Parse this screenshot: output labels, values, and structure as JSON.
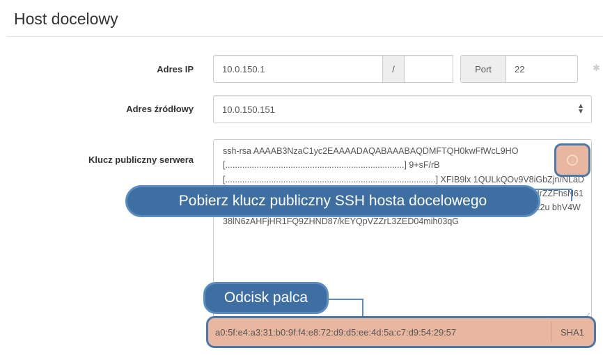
{
  "section": {
    "title": "Host docelowy"
  },
  "ip": {
    "label": "Adres IP",
    "value": "10.0.150.1",
    "mask_separator": "/",
    "mask_value": "",
    "port_label": "Port",
    "port_value": "22"
  },
  "source": {
    "label": "Adres źródłowy",
    "value": "10.0.150.151"
  },
  "key": {
    "label": "Klucz publiczny serwera",
    "text": "ssh-rsa AAAAB3NzaC1yc2EAAAADAQABAAABAQDMFTQH0kwFfWcL9HO [..........................................................................] 9+sF/rB [.......................................................................................] XFIB9lx 1QULkQOv9V8iGbZjn/NLaDD9PKKnmITia6z8ltBr+aG8gRzwMW6J T8EhV0hJOiQqW1XDLMgCIUKXn1XH9iHrZZFhsN61FWiufZGFgn7o N+utuaDDCmVitLgauQEtHLGXzzPtrxklscD9itV+aFfn322oXDBrcZ2u bhV4W38lN6zAHFjHR1FQ9ZHND87/kEYQpVZZrL3ZED04mih03qG"
  },
  "callouts": {
    "fetch_key": "Pobierz klucz publiczny SSH hosta docelowego",
    "fingerprint": "Odcisk palca"
  },
  "fingerprint": {
    "value": "a0:5f:e4:a3:31:b0:9f:f4:e8:72:d9:d5:ee:4d:5a:c7:d9:54:29:57",
    "algorithm": "SHA1"
  },
  "colors": {
    "callout_bg": "#3e6fa3",
    "highlight_bg": "#e9b7a0",
    "highlight_border": "#4a78a8"
  },
  "icons": {
    "settings": "gear-icon",
    "fetch": "download-key-icon",
    "select_caret": "updown-caret-icon"
  }
}
